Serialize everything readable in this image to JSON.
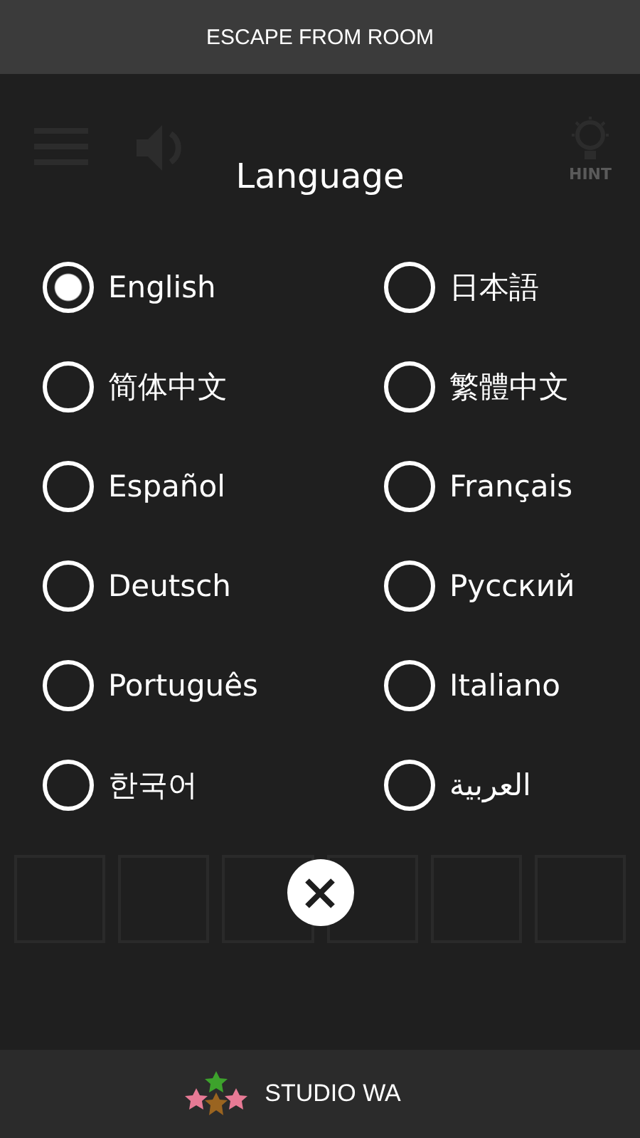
{
  "header": {
    "title": "ESCAPE FROM ROOM"
  },
  "background": {
    "hint_label": "HINT"
  },
  "dialog": {
    "title": "Language",
    "options": [
      {
        "label": "English",
        "selected": true
      },
      {
        "label": "日本語",
        "selected": false
      },
      {
        "label": "简体中文",
        "selected": false
      },
      {
        "label": "繁體中文",
        "selected": false
      },
      {
        "label": "Español",
        "selected": false
      },
      {
        "label": "Français",
        "selected": false
      },
      {
        "label": "Deutsch",
        "selected": false
      },
      {
        "label": "Русский",
        "selected": false
      },
      {
        "label": "Português",
        "selected": false
      },
      {
        "label": "Italiano",
        "selected": false
      },
      {
        "label": "한국어",
        "selected": false
      },
      {
        "label": "العربية",
        "selected": false
      }
    ]
  },
  "footer": {
    "brand": "STUDIO WA"
  }
}
